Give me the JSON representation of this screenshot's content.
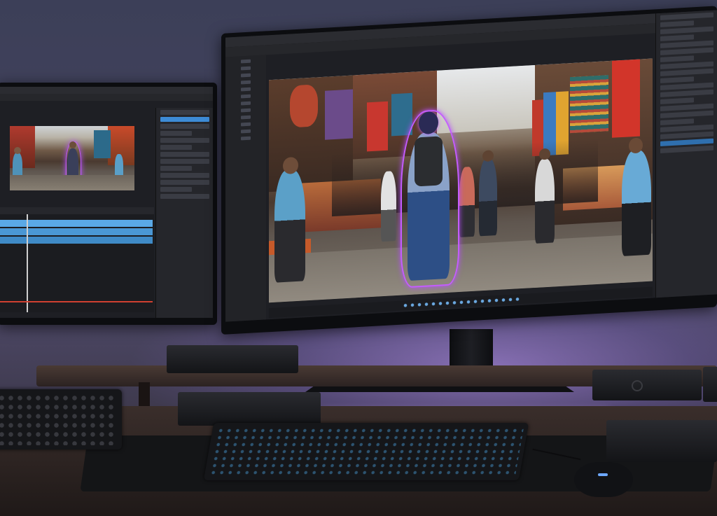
{
  "scene": {
    "description_tags": [
      "dual-monitor",
      "video-editor",
      "market-street"
    ],
    "accent_color": "#c45cff",
    "timeline_color": "#5aa9e6"
  },
  "editor": {
    "left_selected_row": 1,
    "right_selected_row": 4
  }
}
